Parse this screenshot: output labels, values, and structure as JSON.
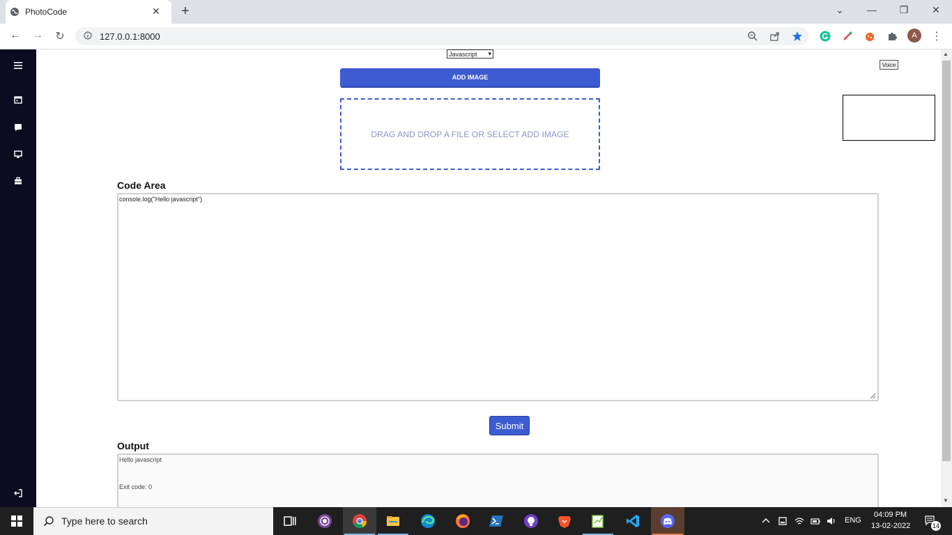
{
  "browser": {
    "tab_title": "PhotoCode",
    "tab_close": "✕",
    "new_tab": "+",
    "window_controls": {
      "dropdown": "⌄",
      "minimize": "—",
      "restore": "❐",
      "close": "✕"
    },
    "nav": {
      "back": "←",
      "forward": "→",
      "reload": "↻"
    },
    "url": "127.0.0.1:8000",
    "avatar_initial": "A",
    "menu": "⋮"
  },
  "page": {
    "language_select": {
      "value": "Javascript",
      "arrow": "▾"
    },
    "add_image_label": "ADD IMAGE",
    "dropzone_text": "DRAG AND DROP A FILE OR SELECT ADD IMAGE",
    "voice_label": "Voice",
    "code_label": "Code Area",
    "code_value": "console.log(\"Hello javascript\")",
    "submit_label": "Submit",
    "output_label": "Output",
    "output_lines": [
      "Hello javascript",
      "Exit code: 0"
    ],
    "scroll_up": "▲",
    "scroll_down": "▼"
  },
  "sidebar": {
    "icons": [
      "menu-icon",
      "calendar-icon",
      "chat-icon",
      "monitor-icon",
      "briefcase-icon",
      "logout-icon"
    ]
  },
  "taskbar": {
    "search_placeholder": "Type here to search",
    "apps": [
      "task-view-icon",
      "tor-browser-icon",
      "chrome-icon",
      "file-explorer-icon",
      "edge-icon",
      "firefox-icon",
      "powershell-icon",
      "github-desktop-icon",
      "brave-icon",
      "notepad-plus-icon",
      "vscode-icon",
      "discord-icon"
    ],
    "language": "ENG",
    "time": "04:09 PM",
    "date": "13-02-2022",
    "notification_count": "14"
  },
  "colors": {
    "accent": "#3d5bd1",
    "sidebar_bg": "#0c0b1f",
    "taskbar_bg": "#1f1f1f"
  }
}
